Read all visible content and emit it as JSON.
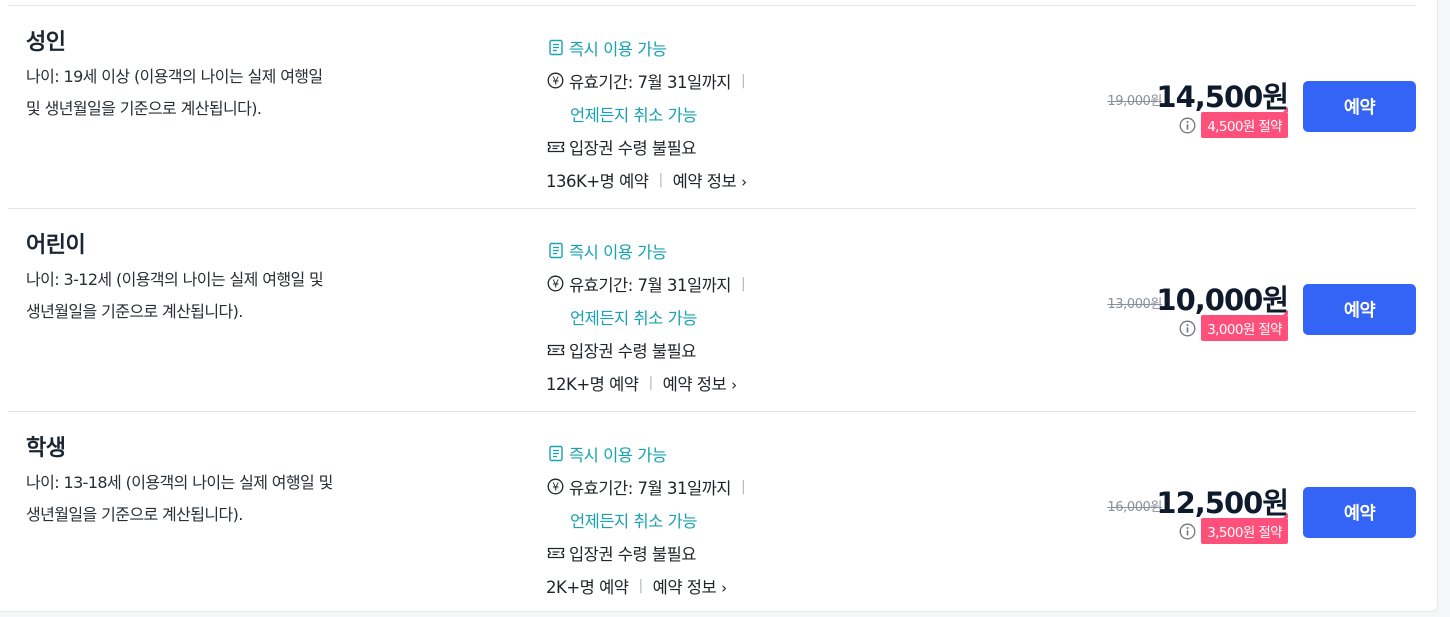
{
  "colors": {
    "accent": "#3464f6",
    "teal": "#19a2b1",
    "badge": "#ff4f7b"
  },
  "icons": {
    "instant": "document-icon",
    "validity": "yen-circle-icon",
    "ticket": "ticket-icon",
    "info": "info-icon",
    "chevron": "chevron-right-icon"
  },
  "options": [
    {
      "title": "성인",
      "desc_line1": "나이: 19세 이상 (이용객의 나이는 실제 여행일",
      "desc_line2": "및 생년월일을 기준으로 계산됩니다).",
      "instant": "즉시 이용 가능",
      "validity": "유효기간: 7월 31일까지",
      "cancel": "언제든지 취소 가능",
      "ticket": "입장권 수령 불필요",
      "booked": "136K+명 예약",
      "info_link": "예약 정보",
      "original_price": "19,000원",
      "price": "14,500원",
      "savings": "4,500원 절약",
      "button": "예약"
    },
    {
      "title": "어린이",
      "desc_line1": "나이: 3-12세 (이용객의 나이는 실제 여행일 및",
      "desc_line2": "생년월일을 기준으로 계산됩니다).",
      "instant": "즉시 이용 가능",
      "validity": "유효기간: 7월 31일까지",
      "cancel": "언제든지 취소 가능",
      "ticket": "입장권 수령 불필요",
      "booked": "12K+명 예약",
      "info_link": "예약 정보",
      "original_price": "13,000원",
      "price": "10,000원",
      "savings": "3,000원 절약",
      "button": "예약"
    },
    {
      "title": "학생",
      "desc_line1": "나이: 13-18세 (이용객의 나이는 실제 여행일 및",
      "desc_line2": "생년월일을 기준으로 계산됩니다).",
      "instant": "즉시 이용 가능",
      "validity": "유효기간: 7월 31일까지",
      "cancel": "언제든지 취소 가능",
      "ticket": "입장권 수령 불필요",
      "booked": "2K+명 예약",
      "info_link": "예약 정보",
      "original_price": "16,000원",
      "price": "12,500원",
      "savings": "3,500원 절약",
      "button": "예약"
    }
  ]
}
